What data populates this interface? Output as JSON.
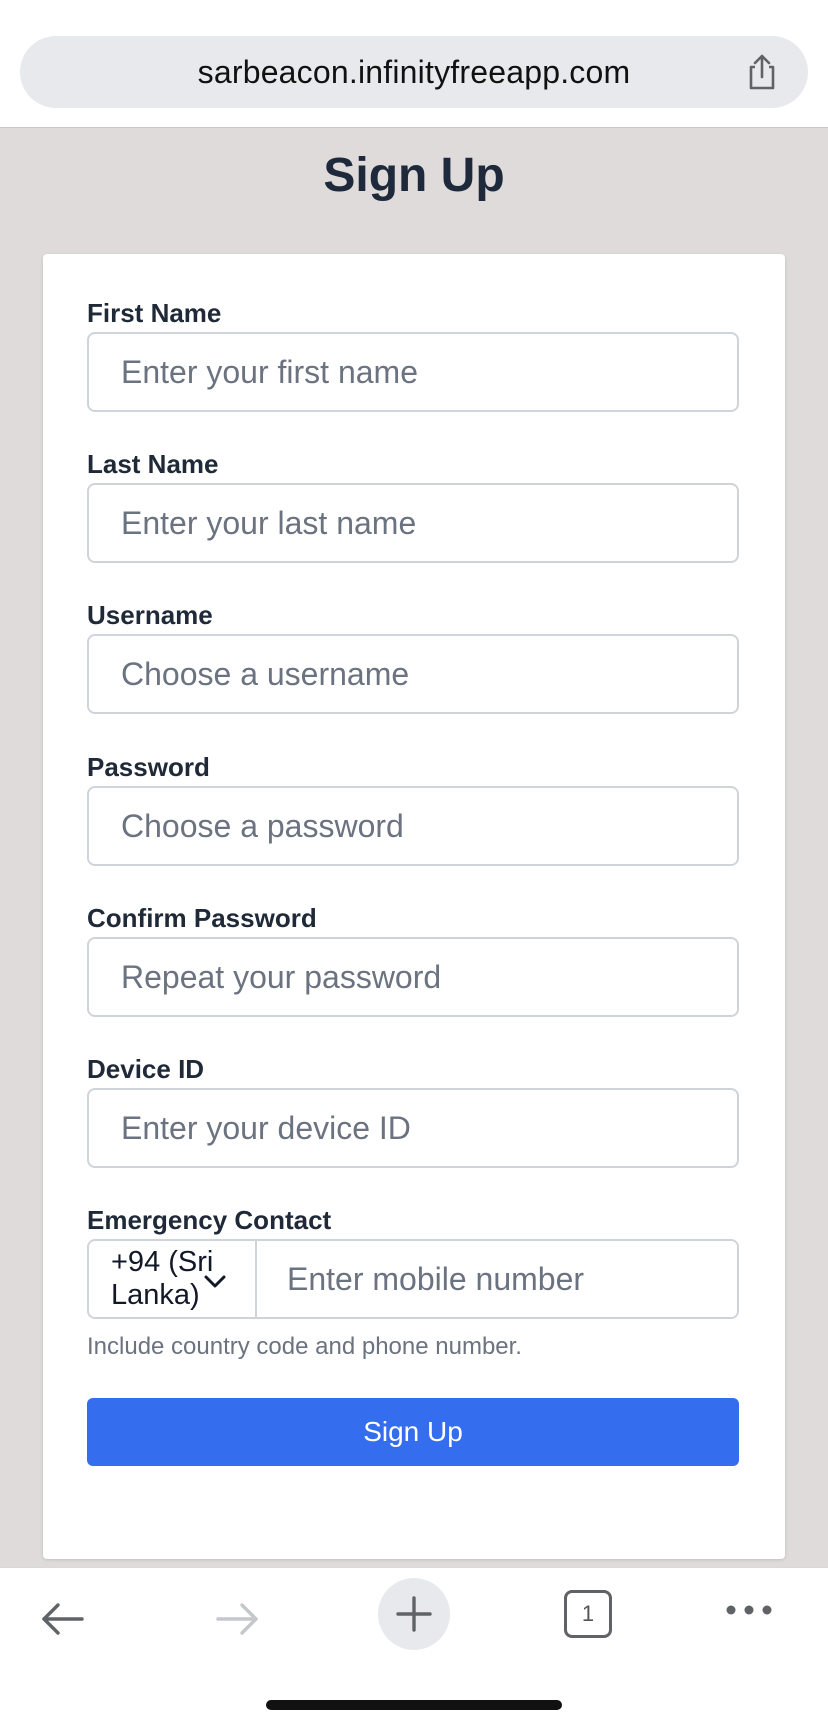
{
  "browser": {
    "url": "sarbeacon.infinityfreeapp.com",
    "tab_count": "1"
  },
  "page": {
    "title": "Sign Up"
  },
  "form": {
    "first_name": {
      "label": "First Name",
      "placeholder": "Enter your first name",
      "value": ""
    },
    "last_name": {
      "label": "Last Name",
      "placeholder": "Enter your last name",
      "value": ""
    },
    "username": {
      "label": "Username",
      "placeholder": "Choose a username",
      "value": ""
    },
    "password": {
      "label": "Password",
      "placeholder": "Choose a password",
      "value": ""
    },
    "confirm_password": {
      "label": "Confirm Password",
      "placeholder": "Repeat your password",
      "value": ""
    },
    "device_id": {
      "label": "Device ID",
      "placeholder": "Enter your device ID",
      "value": ""
    },
    "emergency_contact": {
      "label": "Emergency Contact",
      "country_code": "+94 (Sri Lanka)",
      "mobile_placeholder": "Enter mobile number",
      "help": "Include country code and phone number."
    },
    "submit_label": "Sign Up"
  },
  "colors": {
    "accent": "#356def",
    "page_background": "#dedbda",
    "title": "#1e293b"
  },
  "icons": {
    "share": "share-icon",
    "back": "arrow-left-icon",
    "forward": "arrow-right-icon",
    "new_tab": "plus-icon",
    "tabs": "tabs-icon",
    "more": "more-icon",
    "select": "chevron-down-icon"
  }
}
